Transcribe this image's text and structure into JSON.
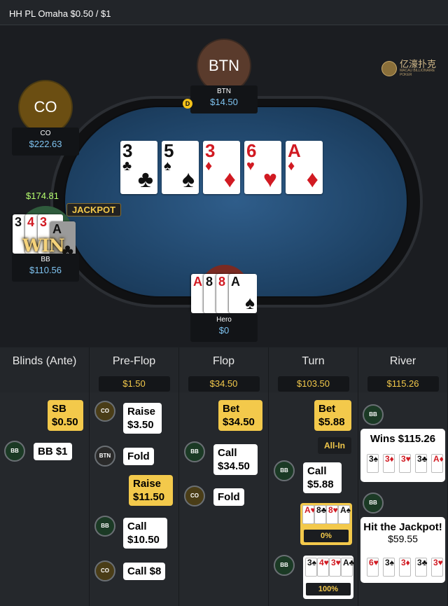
{
  "header": {
    "title": "HH PL Omaha $0.50 / $1"
  },
  "brand": {
    "name": "亿濠扑克",
    "sub": "MACAU BILLIONAIRE POKER"
  },
  "seats": {
    "btn": {
      "circle": "BTN",
      "name": "BTN",
      "stack": "$14.50"
    },
    "co": {
      "circle": "CO",
      "name": "CO",
      "stack": "$222.63"
    },
    "bb": {
      "name": "BB",
      "stack": "$110.56",
      "top_amount": "$174.81"
    },
    "hero": {
      "name": "Hero",
      "stack": "$0"
    }
  },
  "dealer_button": "D",
  "jackpot_label": "JACKPOT",
  "win_label": "WIN",
  "board": [
    {
      "rank": "3",
      "suit": "♣",
      "color": "#111111"
    },
    {
      "rank": "5",
      "suit": "♠",
      "color": "#111111"
    },
    {
      "rank": "3",
      "suit": "♦",
      "color": "#d11a22"
    },
    {
      "rank": "6",
      "suit": "♥",
      "color": "#d11a22"
    },
    {
      "rank": "A",
      "suit": "♦",
      "color": "#d11a22"
    }
  ],
  "bb_cards": [
    {
      "rank": "3",
      "suit": "♠"
    },
    {
      "rank": "4",
      "suit": "♥"
    },
    {
      "rank": "3",
      "suit": "♥"
    },
    {
      "rank": "A",
      "suit": "♣"
    }
  ],
  "hero_cards": [
    {
      "rank": "A",
      "suit": "♥"
    },
    {
      "rank": "8",
      "suit": "♣"
    },
    {
      "rank": "8",
      "suit": "♥"
    },
    {
      "rank": "A",
      "suit": "♠"
    }
  ],
  "streets": [
    {
      "name": "Blinds (Ante)",
      "pot": ""
    },
    {
      "name": "Pre-Flop",
      "pot": "$1.50"
    },
    {
      "name": "Flop",
      "pot": "$34.50"
    },
    {
      "name": "Turn",
      "pot": "$103.50"
    },
    {
      "name": "River",
      "pot": "$115.26"
    }
  ],
  "actions": {
    "blinds": {
      "sb_line1": "SB",
      "sb_line2": "$0.50",
      "bb_chip": "BB",
      "bb_text": "BB $1"
    },
    "preflop": {
      "co_chip": "CO",
      "co_l1": "Raise",
      "co_l2": "$3.50",
      "btn_chip": "BTN",
      "btn_text": "Fold",
      "raise_l1": "Raise",
      "raise_l2": "$11.50",
      "bb_chip": "BB",
      "bb_l1": "Call",
      "bb_l2": "$10.50",
      "co2_chip": "CO",
      "co2_text": "Call $8"
    },
    "flop": {
      "bet_l1": "Bet",
      "bet_l2": "$34.50",
      "bb_chip": "BB",
      "bb_l1": "Call",
      "bb_l2": "$34.50",
      "co_chip": "CO",
      "co_text": "Fold"
    },
    "turn": {
      "bet_l1": "Bet",
      "bet_l2": "$5.88",
      "allin": "All-In",
      "bb_chip": "BB",
      "bb_l1": "Call",
      "bb_l2": "$5.88",
      "hero_hand": [
        "A♥",
        "8♣",
        "8♥",
        "A♠"
      ],
      "hero_pct": "0%",
      "bb2_chip": "BB",
      "bb_hand": [
        "3♠",
        "4♥",
        "3♥",
        "A♣"
      ],
      "bb_pct": "100%"
    },
    "river": {
      "chip1": "BB",
      "res1_title": "Wins $115.26",
      "res1_cards": [
        "3♠",
        "3♦",
        "3♥",
        "3♣",
        "A♦"
      ],
      "chip2": "BB",
      "res2_l1": "Hit the Jackpot!",
      "res2_l2": "$59.55",
      "res2_cards": [
        "6♥",
        "3♠",
        "3♦",
        "3♣",
        "3♥"
      ]
    }
  }
}
